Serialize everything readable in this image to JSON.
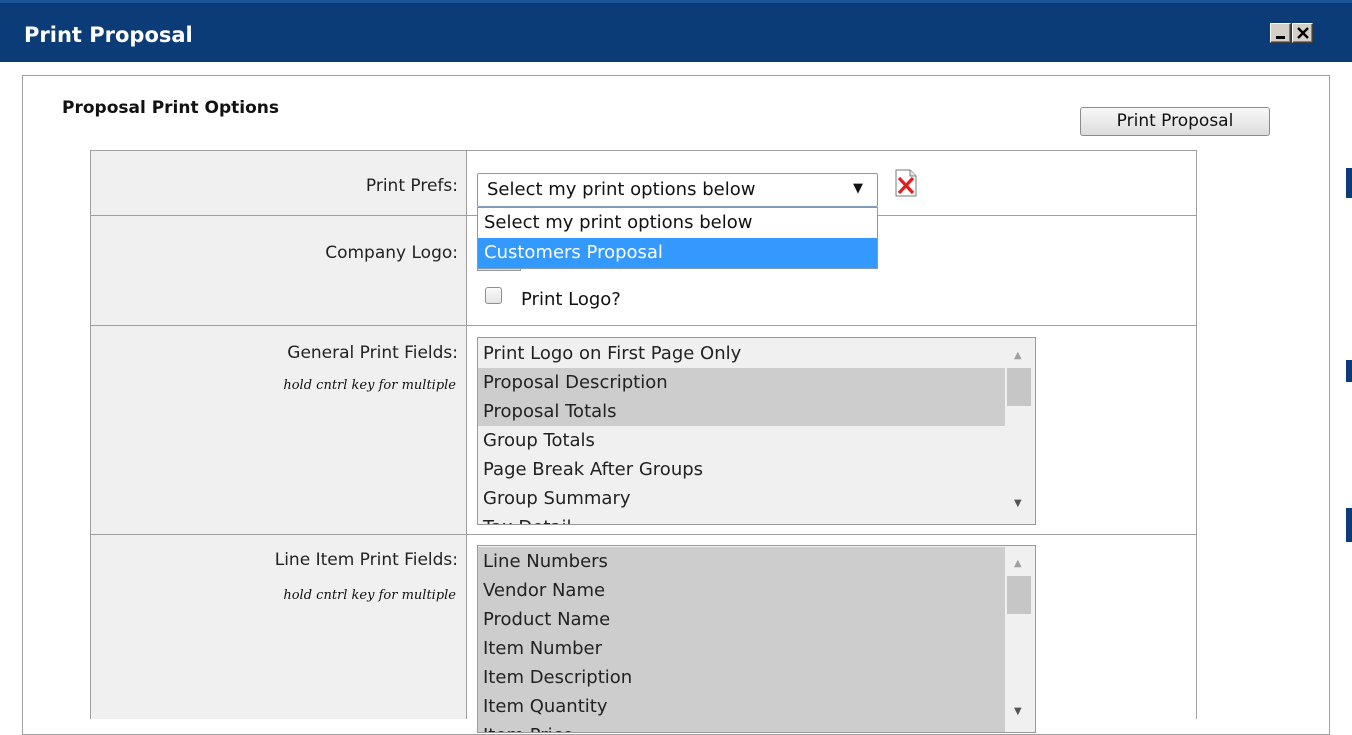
{
  "window": {
    "title": "Print Proposal",
    "minimize_icon": "minimize-icon",
    "close_icon": "close-icon",
    "title_bar_color": "#0b3c77"
  },
  "section": {
    "title": "Proposal Print Options",
    "print_button_label": "Print Proposal"
  },
  "form": {
    "print_prefs": {
      "label": "Print Prefs:",
      "selected_value": "Select my print options below",
      "options": [
        "Select my print options below",
        "Customers Proposal"
      ],
      "highlighted_option": "Customers Proposal",
      "clear_icon": "delete-x-icon"
    },
    "company_logo": {
      "label": "Company Logo:",
      "checkbox_label": "Print Logo?",
      "checked": false
    },
    "general_fields": {
      "label": "General Print Fields:",
      "hint": "hold cntrl key for multiple",
      "items": [
        {
          "text": "Print Logo on First Page Only",
          "selected": false
        },
        {
          "text": "Proposal Description",
          "selected": true
        },
        {
          "text": "Proposal Totals",
          "selected": true
        },
        {
          "text": "Group Totals",
          "selected": false
        },
        {
          "text": "Page Break After Groups",
          "selected": false
        },
        {
          "text": "Group Summary",
          "selected": false
        },
        {
          "text": "Tax Detail",
          "selected": false
        }
      ]
    },
    "line_item_fields": {
      "label": "Line Item Print Fields:",
      "hint": "hold cntrl key for multiple",
      "items": [
        {
          "text": "Line Numbers",
          "selected": true
        },
        {
          "text": "Vendor Name",
          "selected": true
        },
        {
          "text": "Product Name",
          "selected": true
        },
        {
          "text": "Item Number",
          "selected": true
        },
        {
          "text": "Item Description",
          "selected": true
        },
        {
          "text": "Item Quantity",
          "selected": true
        },
        {
          "text": "Item Price",
          "selected": true
        }
      ]
    }
  },
  "colors": {
    "accent": "#3399ff",
    "label_cell_bg": "#f0f0f0",
    "selected_item_bg": "#cdcdcd"
  }
}
